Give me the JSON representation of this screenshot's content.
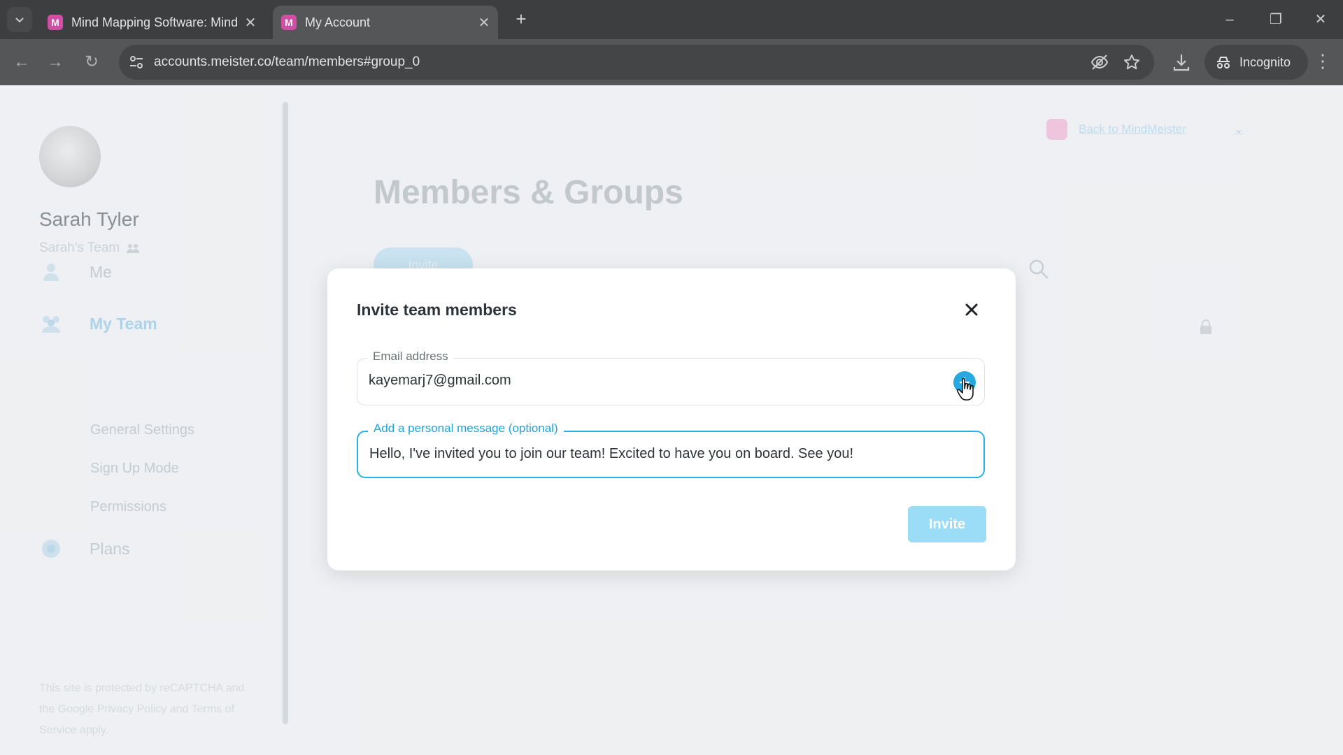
{
  "browser": {
    "tabs": [
      {
        "title": "Mind Mapping Software: Mind",
        "active": false
      },
      {
        "title": "My Account",
        "active": true
      }
    ],
    "url": "accounts.meister.co/team/members#group_0",
    "incognito_label": "Incognito"
  },
  "sidebar": {
    "user_name": "Sarah Tyler",
    "team_name": "Sarah's Team",
    "nav": [
      {
        "label": "Me",
        "icon": "user-icon"
      },
      {
        "label": "My Team",
        "icon": "team-icon"
      },
      {
        "label": "Plans",
        "icon": "plans-icon"
      }
    ],
    "team_sub_items": [
      "General Settings",
      "Sign Up Mode",
      "Permissions"
    ],
    "recaptcha_text": "This site is protected by reCAPTCHA and the Google Privacy Policy and Terms of Service apply."
  },
  "main": {
    "back_link": "Back to MindMeister",
    "page_title": "Members & Groups",
    "invite_button": "Invite"
  },
  "modal": {
    "title": "Invite team members",
    "email_label": "Email address",
    "email_value": "kayemarj7@gmail.com",
    "message_label": "Add a personal message (optional)",
    "message_value": "Hello, I've invited you to join our team! Excited to have you on board. See you!",
    "invite_button": "Invite"
  },
  "colors": {
    "accent": "#27b1e5",
    "invite_disabled": "#9bdcf6",
    "brand_pink": "#d1349a"
  }
}
